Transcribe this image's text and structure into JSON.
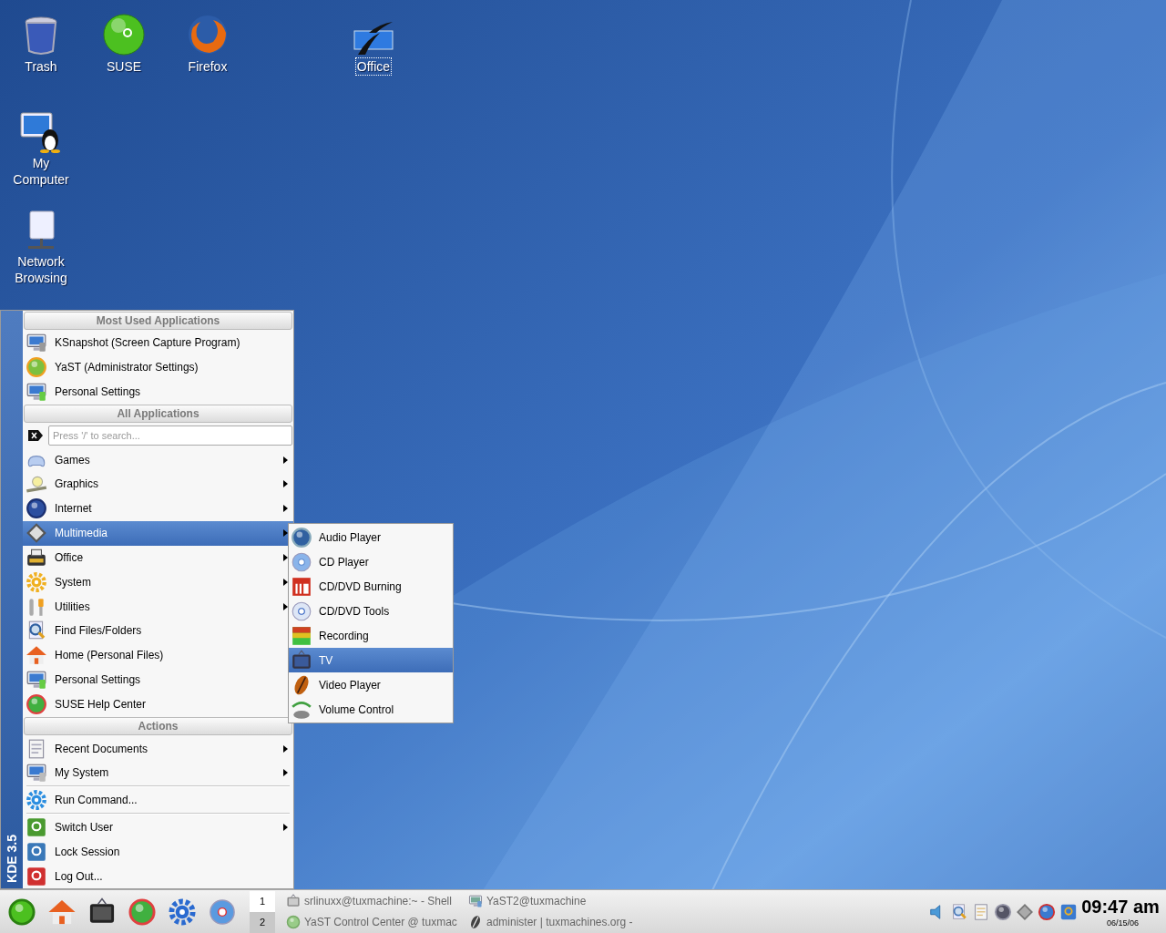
{
  "desktop_icons": [
    {
      "label": "Trash",
      "selected": false
    },
    {
      "label": "SUSE",
      "selected": false
    },
    {
      "label": "Firefox",
      "selected": false
    },
    {
      "label": "Office",
      "selected": true
    },
    {
      "label": "My Computer",
      "selected": false
    },
    {
      "label": "Network Browsing",
      "selected": false
    }
  ],
  "start_menu": {
    "side_label": "KDE 3.5",
    "sections": [
      {
        "title": "Most Used Applications",
        "items": [
          {
            "label": "KSnapshot (Screen Capture Program)",
            "submenu": false,
            "selected": false,
            "separator_above": false
          },
          {
            "label": "YaST (Administrator Settings)",
            "submenu": false,
            "selected": false,
            "separator_above": false
          },
          {
            "label": "Personal Settings",
            "submenu": false,
            "selected": false,
            "separator_above": false
          }
        ]
      },
      {
        "title": "All Applications",
        "search": {
          "placeholder": "Press '/' to search..."
        },
        "items": [
          {
            "label": "Games",
            "submenu": true,
            "selected": false,
            "separator_above": false
          },
          {
            "label": "Graphics",
            "submenu": true,
            "selected": false,
            "separator_above": false
          },
          {
            "label": "Internet",
            "submenu": true,
            "selected": false,
            "separator_above": false
          },
          {
            "label": "Multimedia",
            "submenu": true,
            "selected": true,
            "separator_above": false
          },
          {
            "label": "Office",
            "submenu": true,
            "selected": false,
            "separator_above": false
          },
          {
            "label": "System",
            "submenu": true,
            "selected": false,
            "separator_above": false
          },
          {
            "label": "Utilities",
            "submenu": true,
            "selected": false,
            "separator_above": false
          },
          {
            "label": "Find Files/Folders",
            "submenu": false,
            "selected": false,
            "separator_above": false
          },
          {
            "label": "Home (Personal Files)",
            "submenu": false,
            "selected": false,
            "separator_above": false
          },
          {
            "label": "Personal Settings",
            "submenu": false,
            "selected": false,
            "separator_above": false
          },
          {
            "label": "SUSE Help Center",
            "submenu": false,
            "selected": false,
            "separator_above": false
          }
        ]
      },
      {
        "title": "Actions",
        "items": [
          {
            "label": "Recent Documents",
            "submenu": true,
            "selected": false,
            "separator_above": false
          },
          {
            "label": "My System",
            "submenu": true,
            "selected": false,
            "separator_above": false
          },
          {
            "label": "Run Command...",
            "submenu": false,
            "selected": false,
            "separator_above": true
          },
          {
            "label": "Switch User",
            "submenu": true,
            "selected": false,
            "separator_above": true
          },
          {
            "label": "Lock Session",
            "submenu": false,
            "selected": false,
            "separator_above": false
          },
          {
            "label": "Log Out...",
            "submenu": false,
            "selected": false,
            "separator_above": false
          }
        ]
      }
    ]
  },
  "submenu": {
    "items": [
      {
        "label": "Audio Player",
        "selected": false
      },
      {
        "label": "CD Player",
        "selected": false
      },
      {
        "label": "CD/DVD Burning",
        "selected": false
      },
      {
        "label": "CD/DVD Tools",
        "selected": false
      },
      {
        "label": "Recording",
        "selected": false
      },
      {
        "label": "TV",
        "selected": true
      },
      {
        "label": "Video Player",
        "selected": false
      },
      {
        "label": "Volume Control",
        "selected": false
      }
    ]
  },
  "taskbar": {
    "pager": [
      {
        "label": "1",
        "selected": true
      },
      {
        "label": "2",
        "selected": false
      }
    ],
    "tasks": [
      {
        "label": "srlinuxx@tuxmachine:~ - Shell"
      },
      {
        "label": "YaST2@tuxmachine"
      },
      {
        "label": "YaST Control Center @ tuxmac"
      },
      {
        "label": "administer | tuxmachines.org -"
      }
    ],
    "clock": {
      "time": "09:47 am",
      "date": "06/15/06"
    }
  }
}
